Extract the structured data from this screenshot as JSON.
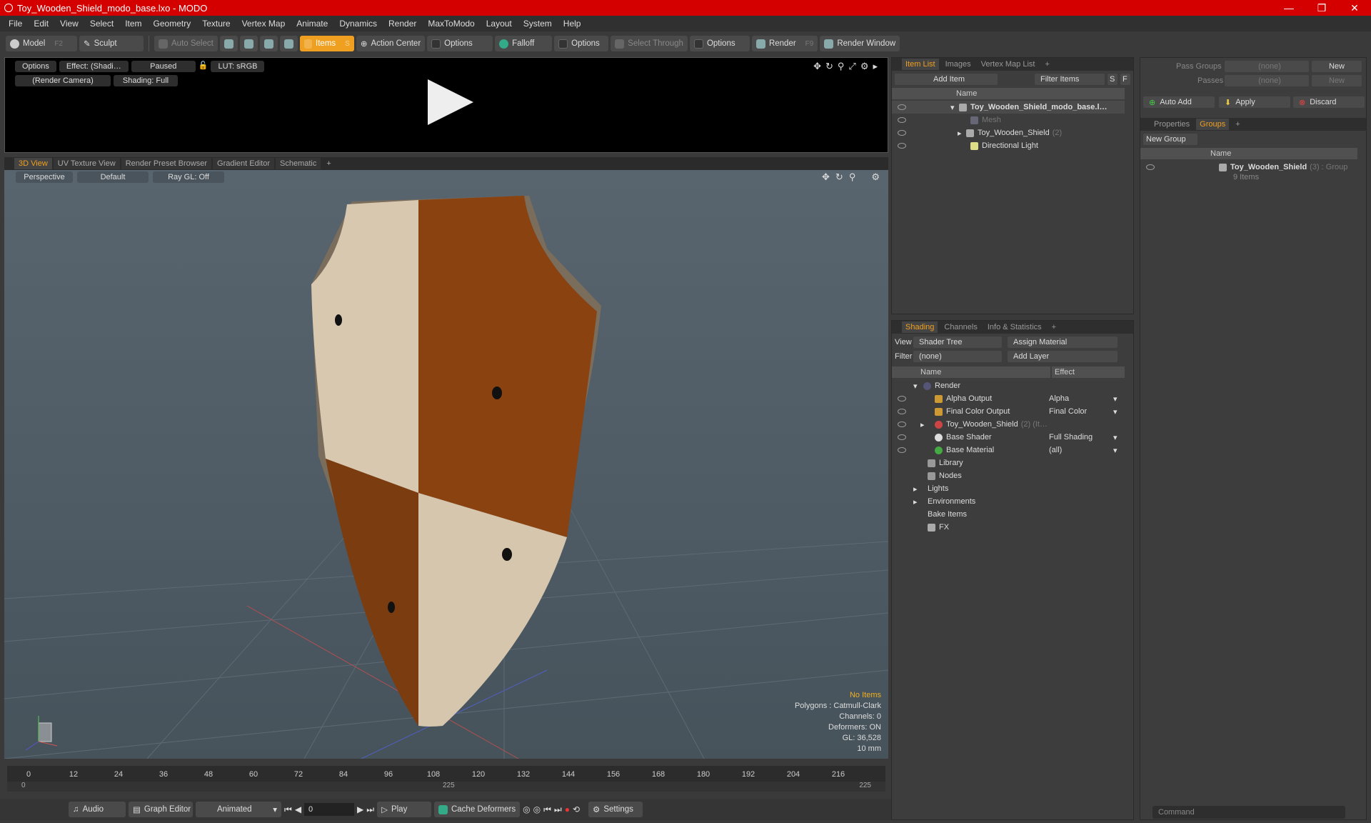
{
  "window": {
    "title": "Toy_Wooden_Shield_modo_base.lxo - MODO"
  },
  "menu": [
    "File",
    "Edit",
    "View",
    "Select",
    "Item",
    "Geometry",
    "Texture",
    "Vertex Map",
    "Animate",
    "Dynamics",
    "Render",
    "MaxToModo",
    "Layout",
    "System",
    "Help"
  ],
  "toolbar": {
    "model": "Model",
    "model_key": "F2",
    "sculpt": "Sculpt",
    "auto_select": "Auto Select",
    "items": "Items",
    "items_key": "S",
    "action_center": "Action Center",
    "options1": "Options",
    "falloff": "Falloff",
    "options2": "Options",
    "select_through": "Select Through",
    "options3": "Options",
    "render": "Render",
    "render_key": "F9",
    "render_window": "Render Window"
  },
  "render_preview": {
    "options": "Options",
    "effect": "Effect: (Shadi…",
    "paused": "Paused",
    "lut": "LUT: sRGB",
    "camera": "(Render Camera)",
    "shading": "Shading: Full"
  },
  "view_tabs": [
    "3D View",
    "UV Texture View",
    "Render Preset Browser",
    "Gradient Editor",
    "Schematic",
    "+"
  ],
  "viewport": {
    "perspective": "Perspective",
    "default": "Default",
    "raygl": "Ray GL: Off",
    "stats": {
      "noitems": "No Items",
      "polygons": "Polygons : Catmull-Clark",
      "channels": "Channels: 0",
      "deformers": "Deformers: ON",
      "gl": "GL: 36,528",
      "scale": "10 mm"
    }
  },
  "timeline": {
    "ticks": [
      "0",
      "12",
      "24",
      "36",
      "48",
      "60",
      "72",
      "84",
      "96",
      "108",
      "120",
      "132",
      "144",
      "156",
      "168",
      "180",
      "192",
      "204",
      "216"
    ],
    "start": "0",
    "mid": "225",
    "end": "225"
  },
  "bottom": {
    "audio": "Audio",
    "graph_editor": "Graph Editor",
    "animated": "Animated",
    "frame": "0",
    "play": "Play",
    "cache": "Cache Deformers",
    "settings": "Settings"
  },
  "item_list": {
    "tabs": [
      "Item List",
      "Images",
      "Vertex Map List",
      "+"
    ],
    "add_item": "Add Item",
    "filter_items": "Filter Items",
    "s": "S",
    "f": "F",
    "col_name": "Name",
    "items": [
      "Toy_Wooden_Shield_modo_base.l…",
      "Mesh",
      "Toy_Wooden_Shield",
      "Directional Light"
    ],
    "shield_count": "(2)"
  },
  "shading": {
    "tabs": [
      "Shading",
      "Channels",
      "Info & Statistics",
      "+"
    ],
    "view_label": "View",
    "view_value": "Shader Tree",
    "assign": "Assign Material",
    "filter_label": "Filter",
    "filter_value": "(none)",
    "add_layer": "Add Layer",
    "col_name": "Name",
    "col_effect": "Effect",
    "rows": [
      {
        "name": "Render",
        "effect": ""
      },
      {
        "name": "Alpha Output",
        "effect": "Alpha"
      },
      {
        "name": "Final Color Output",
        "effect": "Final Color"
      },
      {
        "name": "Toy_Wooden_Shield",
        "effect": "",
        "suffix": "(2) (It…"
      },
      {
        "name": "Base Shader",
        "effect": "Full Shading"
      },
      {
        "name": "Base Material",
        "effect": "(all)"
      },
      {
        "name": "Library",
        "effect": ""
      },
      {
        "name": "Nodes",
        "effect": ""
      },
      {
        "name": "Lights",
        "effect": ""
      },
      {
        "name": "Environments",
        "effect": ""
      },
      {
        "name": "Bake Items",
        "effect": ""
      },
      {
        "name": "FX",
        "effect": ""
      }
    ]
  },
  "groups": {
    "pass_groups_label": "Pass Groups",
    "pass_groups_value": "(none)",
    "new1": "New",
    "passes_label": "Passes",
    "passes_value": "(none)",
    "new2": "New",
    "auto_add": "Auto Add",
    "apply": "Apply",
    "discard": "Discard",
    "tabs": [
      "Properties",
      "Groups",
      "+"
    ],
    "new_group": "New Group",
    "col_name": "Name",
    "group_name": "Toy_Wooden_Shield",
    "group_suffix": "(3) : Group",
    "group_items": "9 Items"
  },
  "command": {
    "placeholder": "Command"
  }
}
